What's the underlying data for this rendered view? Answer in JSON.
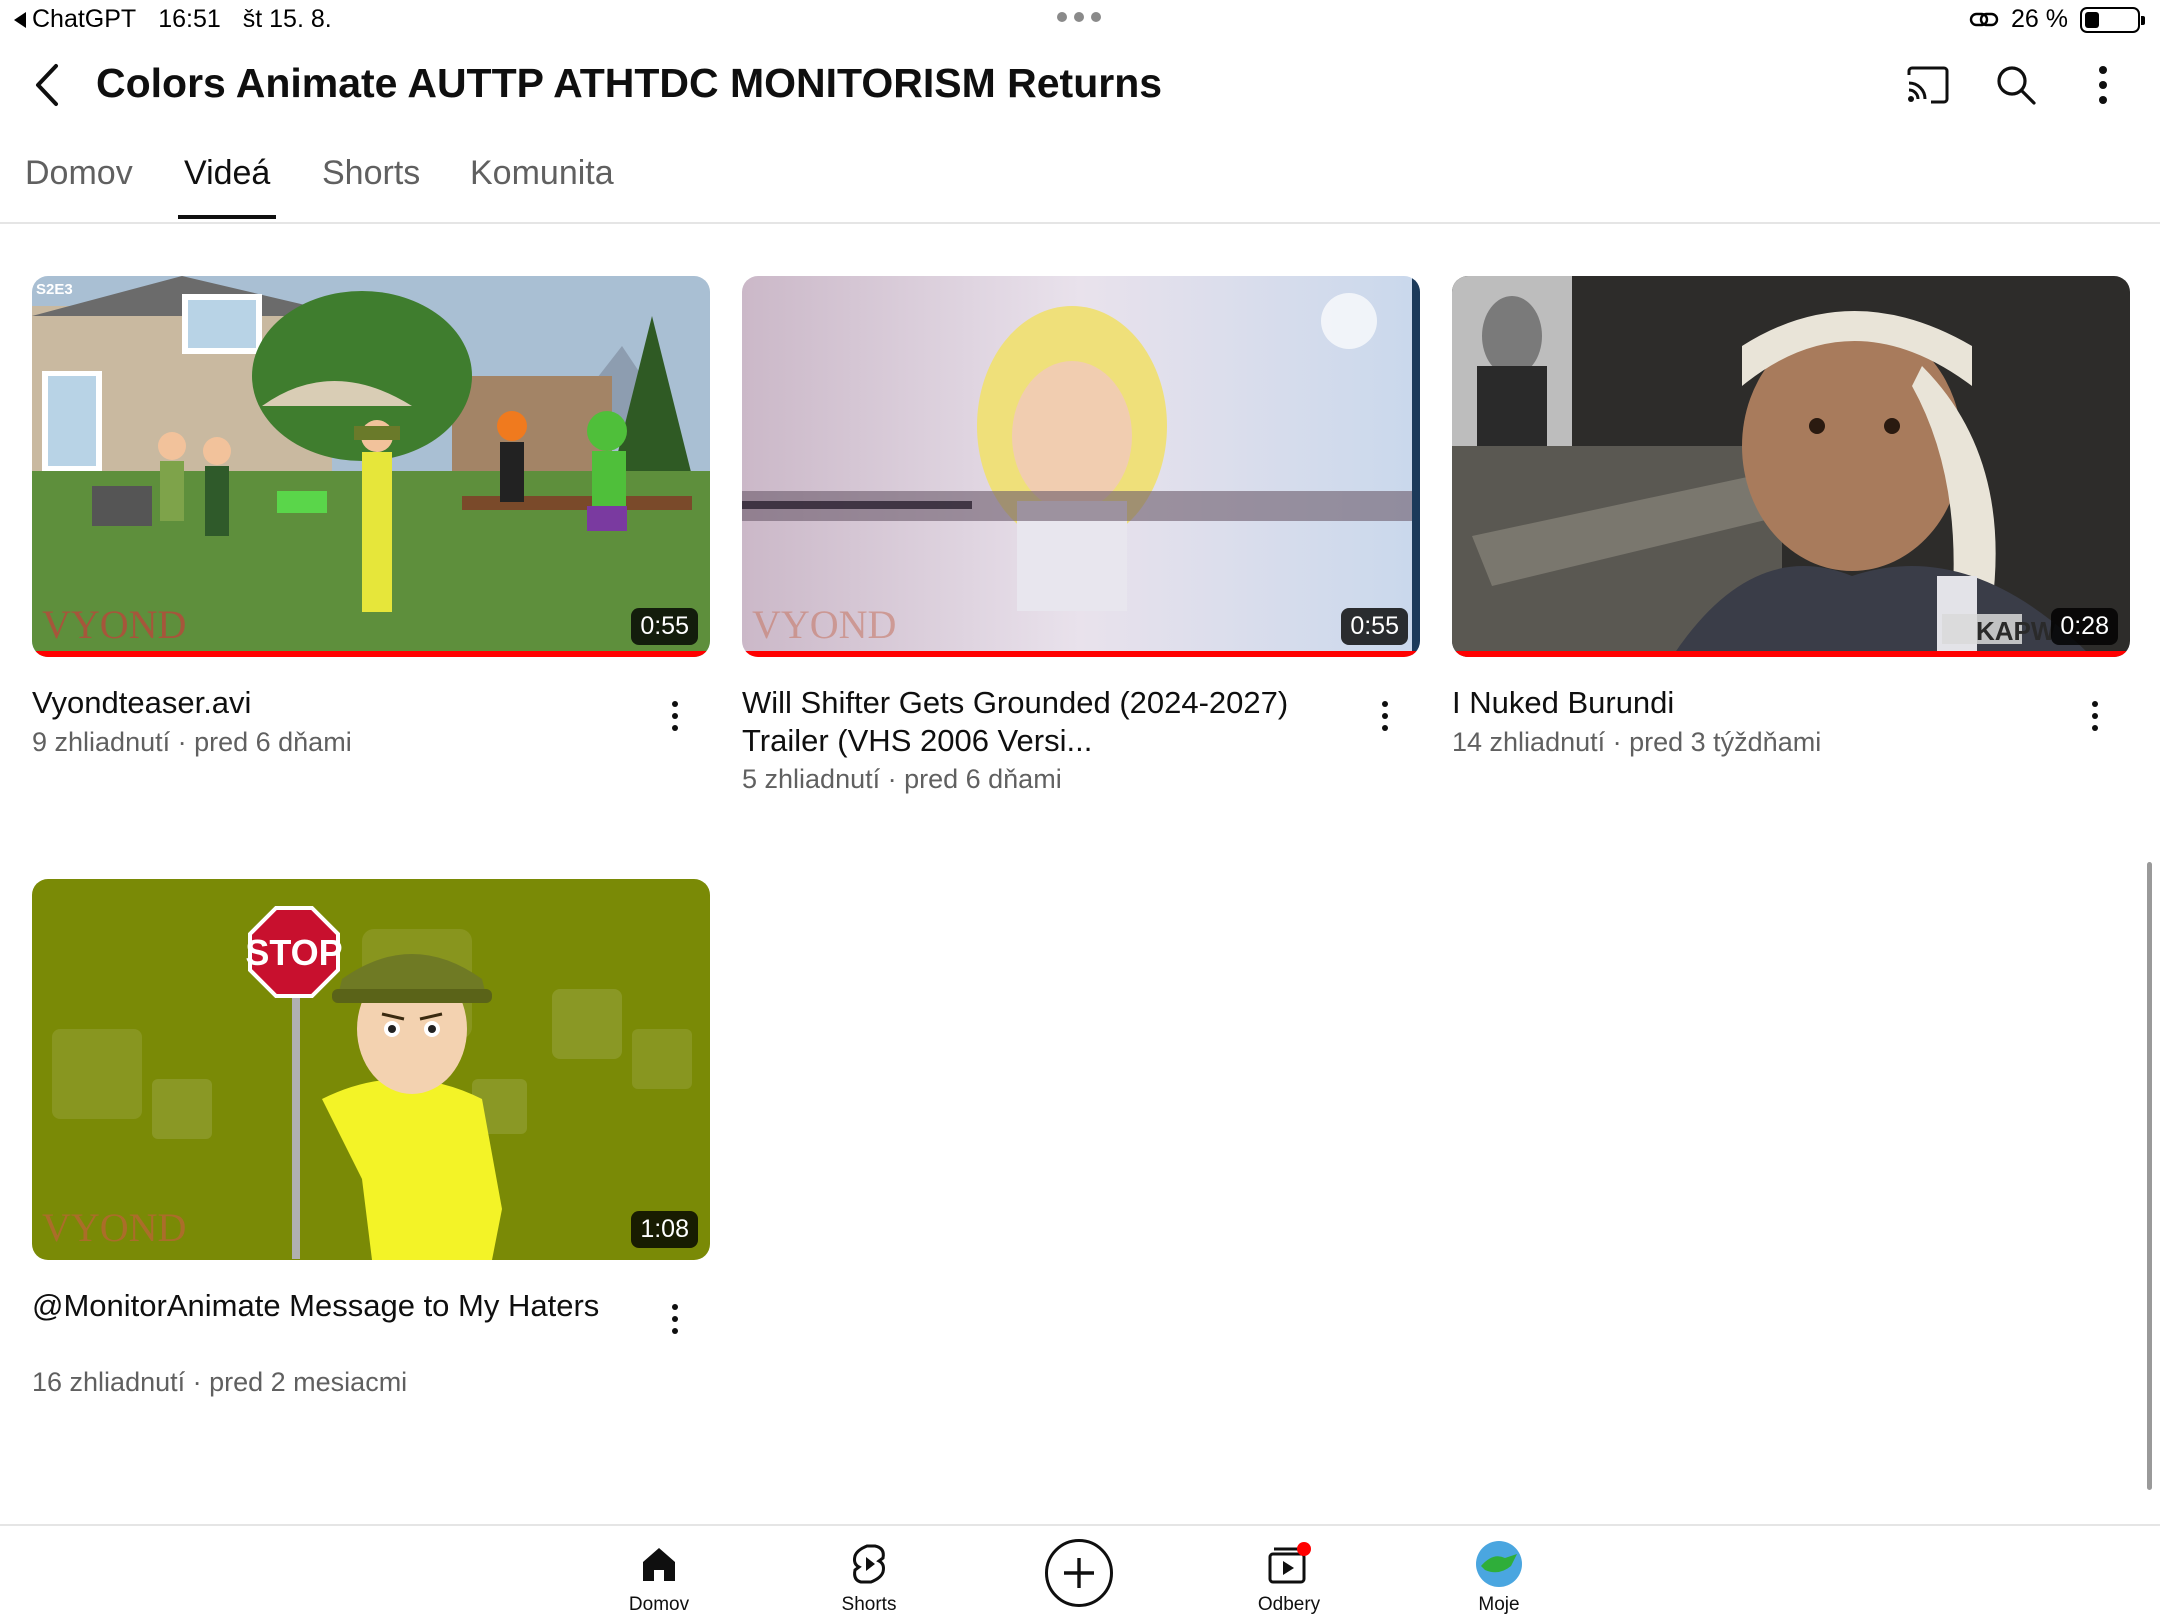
{
  "status_bar": {
    "back_app": "ChatGPT",
    "time": "16:51",
    "date": "št 15. 8.",
    "battery": "26 %",
    "battery_level": 0.26
  },
  "header": {
    "channel_title": "Colors Animate AUTTP ATHTDC MONITORISM Returns",
    "icons": [
      "back-arrow-icon",
      "cast-icon",
      "search-icon",
      "more-vert-icon"
    ]
  },
  "tabs": [
    {
      "label": "Domov",
      "active": false
    },
    {
      "label": "Videá",
      "active": true
    },
    {
      "label": "Shorts",
      "active": false
    },
    {
      "label": "Komunita",
      "active": false
    }
  ],
  "videos": [
    {
      "title": "Vyondteaser.avi",
      "meta": "9 zhliadnutí · pred 6 dňami",
      "duration": "0:55",
      "thumb_badge": "S2E3",
      "watermark": "VYOND",
      "watched_fraction": 1.0
    },
    {
      "title": "Will Shifter Gets Grounded (2024-2027) Trailer (VHS 2006 Versi...",
      "meta": "5 zhliadnutí · pred 6 dňami",
      "duration": "0:55",
      "watermark": "VYOND",
      "watched_fraction": 1.0
    },
    {
      "title": "I Nuked Burundi",
      "meta": "14 zhliadnutí · pred 3 týždňami",
      "duration": "0:28",
      "watermark": "KAPW",
      "watched_fraction": 1.0
    },
    {
      "title": "@MonitorAnimate Message to My Haters",
      "meta": "16 zhliadnutí · pred 2 mesiacmi",
      "duration": "1:08",
      "thumb_sign": "STOP",
      "watermark": "VYOND",
      "watched_fraction": 0.0
    }
  ],
  "bottom_nav": [
    {
      "label": "Domov",
      "icon": "home-icon"
    },
    {
      "label": "Shorts",
      "icon": "shorts-icon"
    },
    {
      "label": "",
      "icon": "create-plus-icon"
    },
    {
      "label": "Odbery",
      "icon": "subscriptions-icon"
    },
    {
      "label": "Moje",
      "icon": "avatar-icon"
    }
  ],
  "colors": {
    "progress": "#ff0000",
    "text_primary": "#0f0f0f",
    "text_secondary": "#606060",
    "notification_dot": "#ff0000"
  }
}
